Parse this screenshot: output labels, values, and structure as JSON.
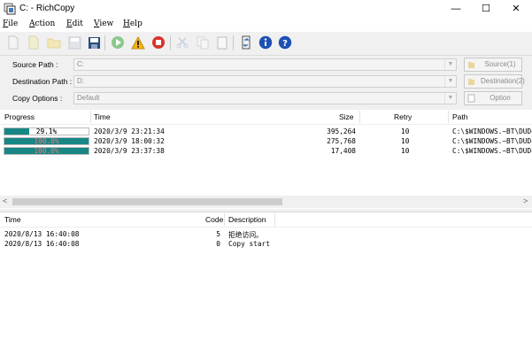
{
  "window": {
    "title": "C: - RichCopy",
    "icon": "richcopy-app-icon"
  },
  "window_controls": {
    "minimize": "—",
    "maximize": "☐",
    "close": "✕"
  },
  "menu": [
    {
      "hot": "F",
      "rest": "ile"
    },
    {
      "hot": "A",
      "rest": "ction"
    },
    {
      "hot": "E",
      "rest": "dit"
    },
    {
      "hot": "V",
      "rest": "iew"
    },
    {
      "hot": "H",
      "rest": "elp"
    }
  ],
  "toolbar": {
    "icons": [
      "new-file-icon",
      "open-file-icon",
      "open-folder-icon",
      "save-icon",
      "save-as-icon",
      "start-icon",
      "warning-icon",
      "stop-icon",
      "cut-icon",
      "copy-icon",
      "paste-icon",
      "sync-icon",
      "info-icon",
      "help-icon"
    ],
    "colors": {
      "start": "#8bc98b",
      "warning": "#f4b41a",
      "stop": "#d9342b",
      "info": "#1e50b4",
      "help": "#1e50b4",
      "save": "#2a4a7a"
    }
  },
  "form": {
    "source_label": "Source Path :",
    "source_value": "C:",
    "source_button": "Source(1)",
    "dest_label": "Destination Path :",
    "dest_value": "D:",
    "dest_button": "Destination(2)",
    "options_label": "Copy Options :",
    "options_value": "Default",
    "options_button": "Option"
  },
  "progress_table": {
    "headers": {
      "progress": "Progress",
      "time": "Time",
      "size": "Size",
      "retry": "Retry",
      "path": "Path"
    },
    "rows": [
      {
        "progress_pct": 29.1,
        "progress_text": "29.1%",
        "time": "2020/3/9 23:21:34",
        "size": "395,264",
        "retry": "10",
        "path": "C:\\$WINDOWS.~BT\\DUDo"
      },
      {
        "progress_pct": 100,
        "progress_text": "100.0%",
        "time": "2020/3/9 18:00:32",
        "size": "275,768",
        "retry": "10",
        "path": "C:\\$WINDOWS.~BT\\DUDo"
      },
      {
        "progress_pct": 100,
        "progress_text": "100.0%",
        "time": "2020/3/9 23:37:38",
        "size": "17,408",
        "retry": "10",
        "path": "C:\\$WINDOWS.~BT\\DUDo"
      }
    ],
    "accent": "#178685"
  },
  "scrollbar": {
    "left_arrow": "<",
    "right_arrow": ">"
  },
  "log_table": {
    "headers": {
      "time": "Time",
      "code": "Code",
      "description": "Description"
    },
    "rows": [
      {
        "time": "2020/8/13 16:40:08",
        "code": "5",
        "description": "拒绝访问。"
      },
      {
        "time": "2020/8/13 16:40:08",
        "code": "0",
        "description": "Copy start"
      }
    ]
  }
}
